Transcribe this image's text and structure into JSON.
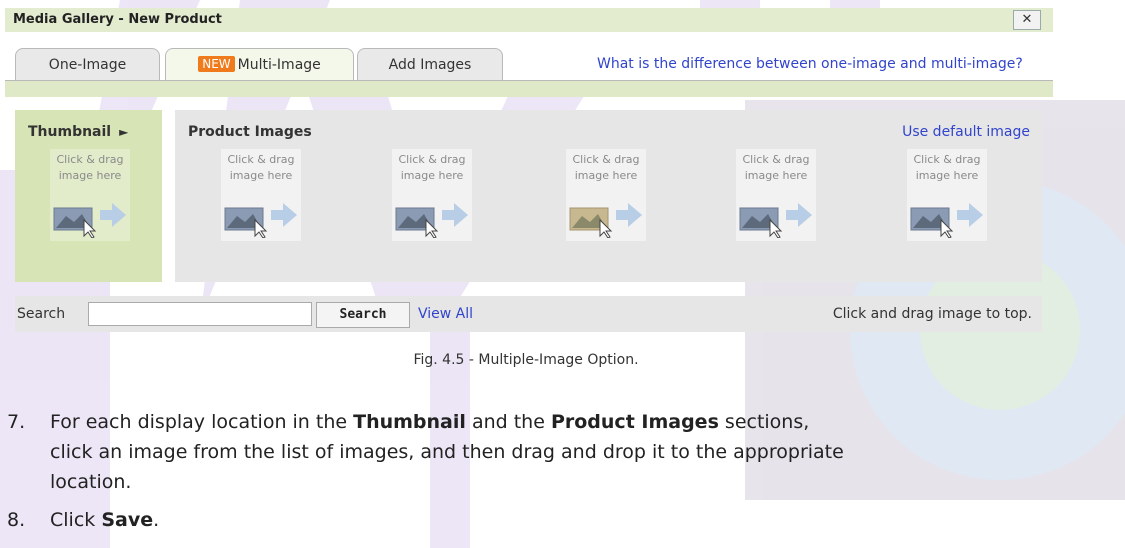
{
  "dialog": {
    "title": "Media Gallery - New Product",
    "close_symbol": "✕",
    "tabs": [
      {
        "label": "One-Image",
        "badge": ""
      },
      {
        "label": "Multi-Image",
        "badge": "NEW"
      },
      {
        "label": "Add Images",
        "badge": ""
      }
    ],
    "help_link": "What is the difference between one-image and multi-image?",
    "thumbnail": {
      "title": "Thumbnail",
      "arrow": "►"
    },
    "product_images": {
      "title": "Product Images",
      "default_link": "Use default image"
    },
    "slot_text_line1": "Click & drag",
    "slot_text_line2": "image here",
    "search": {
      "label": "Search",
      "input_value": "",
      "button": "Search",
      "view_all": "View All",
      "hint": "Click and drag image to top."
    }
  },
  "caption": "Fig. 4.5 - Multiple-Image Option.",
  "steps": [
    {
      "number": "7.",
      "text_1": "For each display location in the ",
      "bold_1": "Thumbnail",
      "text_2": " and the ",
      "bold_2": "Product Images",
      "text_3": " sections, click an image from the list of images, and then drag and drop it to the appropriate location."
    },
    {
      "number": "8.",
      "text_1": "Click ",
      "bold_1": "Save",
      "text_2": "."
    }
  ],
  "colors": {
    "link": "#3144cc",
    "badge": "#f07b1d",
    "titlebar": "#e4ecd0",
    "thumbnail_panel": "#d6e4b6"
  }
}
